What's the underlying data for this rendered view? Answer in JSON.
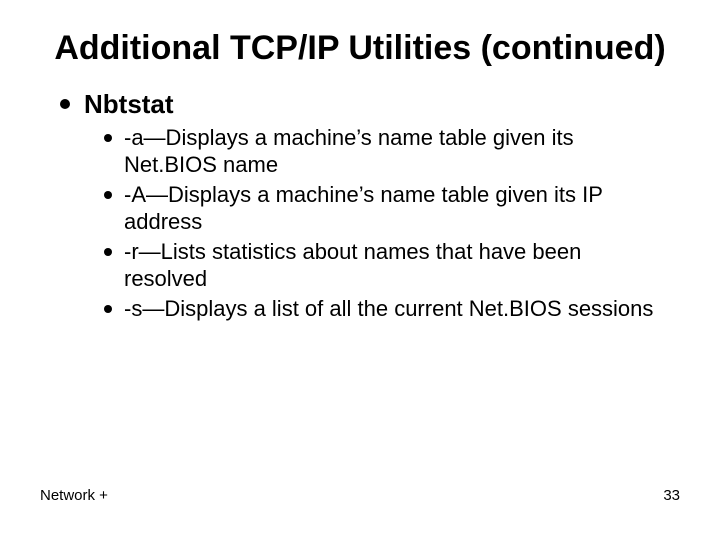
{
  "title": "Additional TCP/IP Utilities (continued)",
  "main": {
    "heading": "Nbtstat",
    "items": [
      "-a—Displays a machine’s name table given its Net.BIOS name",
      "-A—Displays a machine’s name table given its IP address",
      "-r—Lists statistics about names that have been resolved",
      "-s—Displays a list of all the current Net.BIOS sessions"
    ]
  },
  "footer": {
    "left": "Network +",
    "right": "33"
  }
}
